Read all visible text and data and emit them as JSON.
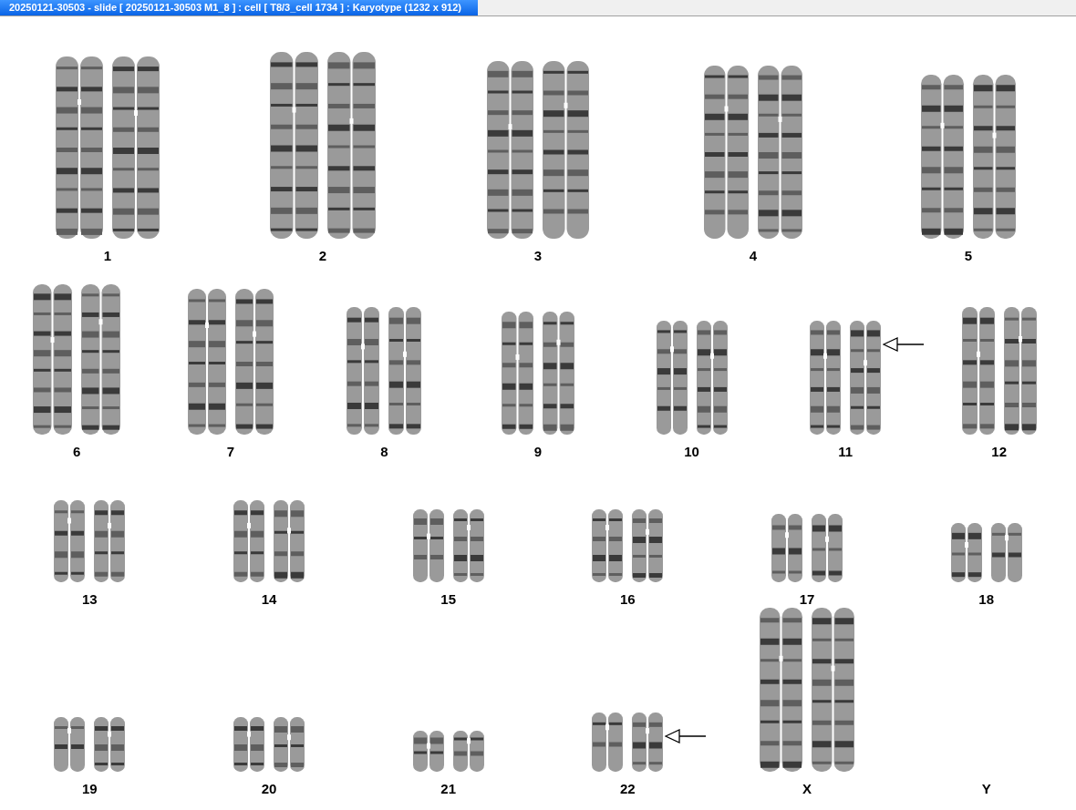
{
  "window": {
    "title": "20250121-30503 - slide [ 20250121-30503 M1_8 ] : cell [ T8/3_cell 1734 ] : Karyotype  (1232 x 912)"
  },
  "karyogram": {
    "rows": [
      {
        "groups": [
          {
            "label": "1",
            "kind": "pair",
            "arrow": false
          },
          {
            "label": "2",
            "kind": "pair",
            "arrow": false
          },
          {
            "label": "3",
            "kind": "pair",
            "arrow": false
          },
          {
            "label": "4",
            "kind": "pair",
            "arrow": false
          },
          {
            "label": "5",
            "kind": "pair",
            "arrow": false
          }
        ]
      },
      {
        "groups": [
          {
            "label": "6",
            "kind": "pair",
            "arrow": false
          },
          {
            "label": "7",
            "kind": "pair",
            "arrow": false
          },
          {
            "label": "8",
            "kind": "pair",
            "arrow": false
          },
          {
            "label": "9",
            "kind": "pair",
            "arrow": false
          },
          {
            "label": "10",
            "kind": "pair",
            "arrow": false
          },
          {
            "label": "11",
            "kind": "pair",
            "arrow": true
          },
          {
            "label": "12",
            "kind": "pair",
            "arrow": false
          }
        ]
      },
      {
        "groups": [
          {
            "label": "13",
            "kind": "pair",
            "arrow": false
          },
          {
            "label": "14",
            "kind": "pair",
            "arrow": false
          },
          {
            "label": "15",
            "kind": "pair",
            "arrow": false
          },
          {
            "label": "16",
            "kind": "pair",
            "arrow": false
          },
          {
            "label": "17",
            "kind": "pair",
            "arrow": false
          },
          {
            "label": "18",
            "kind": "pair",
            "arrow": false
          }
        ]
      },
      {
        "groups": [
          {
            "label": "19",
            "kind": "pair",
            "arrow": false
          },
          {
            "label": "20",
            "kind": "pair",
            "arrow": false
          },
          {
            "label": "21",
            "kind": "pair",
            "arrow": false
          },
          {
            "label": "22",
            "kind": "pair",
            "arrow": true
          },
          {
            "label": "X",
            "kind": "pair",
            "arrow": false
          },
          {
            "label": "Y",
            "kind": "empty",
            "arrow": false
          }
        ]
      }
    ]
  }
}
